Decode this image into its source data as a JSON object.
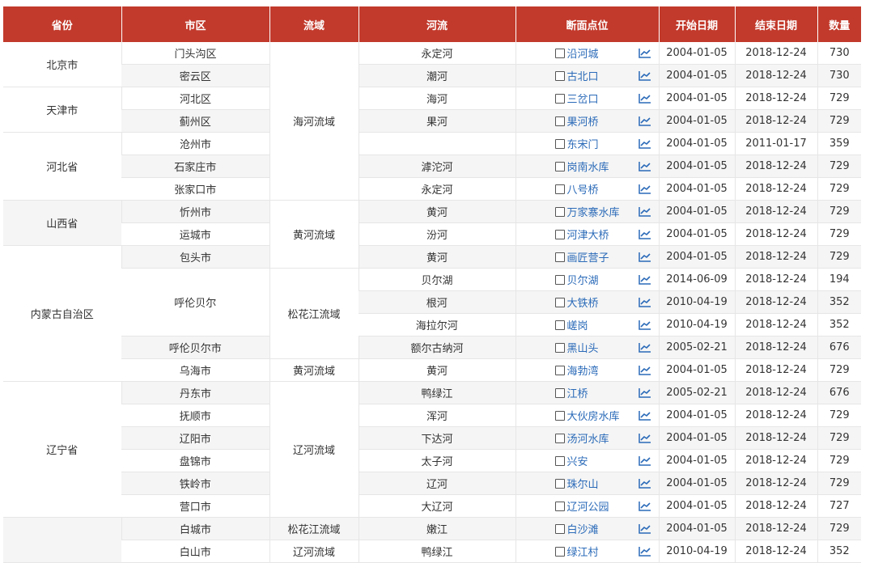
{
  "header": {
    "province": "省份",
    "city": "市区",
    "basin": "流域",
    "river": "河流",
    "site": "断面点位",
    "start": "开始日期",
    "end": "结束日期",
    "count": "数量"
  },
  "colors": {
    "header_bg": "#c23a2c",
    "link": "#2a6ab8",
    "row_alt": "#f5f5f5"
  },
  "icons": {
    "checkbox": "checkbox-icon",
    "trend": "line-chart-icon"
  },
  "provinces": [
    "北京市",
    "天津市",
    "河北省",
    "山西省",
    "内蒙古自治区",
    "辽宁省",
    ""
  ],
  "basins": [
    "海河流域",
    "黄河流域",
    "松花江流域",
    "黄河流域",
    "辽河流域",
    "松花江流域",
    "辽河流域"
  ],
  "cities": [
    "门头沟区",
    "密云区",
    "河北区",
    "蓟州区",
    "沧州市",
    "石家庄市",
    "张家口市",
    "忻州市",
    "运城市",
    "包头市",
    "呼伦贝尔",
    "呼伦贝尔市",
    "乌海市",
    "丹东市",
    "抚顺市",
    "辽阳市",
    "盘锦市",
    "铁岭市",
    "营口市",
    "白城市",
    "白山市"
  ],
  "rivers": [
    "永定河",
    "潮河",
    "海河",
    "果河",
    "",
    "滹沱河",
    "永定河",
    "黄河",
    "汾河",
    "黄河",
    "贝尔湖",
    "根河",
    "海拉尔河",
    "额尔古纳河",
    "黄河",
    "鸭绿江",
    "浑河",
    "下达河",
    "太子河",
    "辽河",
    "大辽河",
    "嫩江",
    "鸭绿江"
  ],
  "rows": [
    {
      "site": "沿河城",
      "start": "2004-01-05",
      "end": "2018-12-24",
      "count": "730"
    },
    {
      "site": "古北口",
      "start": "2004-01-05",
      "end": "2018-12-24",
      "count": "730"
    },
    {
      "site": "三岔口",
      "start": "2004-01-05",
      "end": "2018-12-24",
      "count": "729"
    },
    {
      "site": "果河桥",
      "start": "2004-01-05",
      "end": "2018-12-24",
      "count": "729"
    },
    {
      "site": "东宋门",
      "start": "2004-01-05",
      "end": "2011-01-17",
      "count": "359"
    },
    {
      "site": "岗南水库",
      "start": "2004-01-05",
      "end": "2018-12-24",
      "count": "729"
    },
    {
      "site": "八号桥",
      "start": "2004-01-05",
      "end": "2018-12-24",
      "count": "729"
    },
    {
      "site": "万家寨水库",
      "start": "2004-01-05",
      "end": "2018-12-24",
      "count": "729"
    },
    {
      "site": "河津大桥",
      "start": "2004-01-05",
      "end": "2018-12-24",
      "count": "729"
    },
    {
      "site": "画匠营子",
      "start": "2004-01-05",
      "end": "2018-12-24",
      "count": "729"
    },
    {
      "site": "贝尔湖",
      "start": "2014-06-09",
      "end": "2018-12-24",
      "count": "194"
    },
    {
      "site": "大铁桥",
      "start": "2010-04-19",
      "end": "2018-12-24",
      "count": "352"
    },
    {
      "site": "嵯岗",
      "start": "2010-04-19",
      "end": "2018-12-24",
      "count": "352"
    },
    {
      "site": "黑山头",
      "start": "2005-02-21",
      "end": "2018-12-24",
      "count": "676"
    },
    {
      "site": "海勃湾",
      "start": "2004-01-05",
      "end": "2018-12-24",
      "count": "729"
    },
    {
      "site": "江桥",
      "start": "2005-02-21",
      "end": "2018-12-24",
      "count": "676"
    },
    {
      "site": "大伙房水库",
      "start": "2004-01-05",
      "end": "2018-12-24",
      "count": "729"
    },
    {
      "site": "汤河水库",
      "start": "2004-01-05",
      "end": "2018-12-24",
      "count": "729"
    },
    {
      "site": "兴安",
      "start": "2004-01-05",
      "end": "2018-12-24",
      "count": "729"
    },
    {
      "site": "珠尔山",
      "start": "2004-01-05",
      "end": "2018-12-24",
      "count": "729"
    },
    {
      "site": "辽河公园",
      "start": "2004-01-05",
      "end": "2018-12-24",
      "count": "727"
    },
    {
      "site": "白沙滩",
      "start": "2004-01-05",
      "end": "2018-12-24",
      "count": "729"
    },
    {
      "site": "绿江村",
      "start": "2010-04-19",
      "end": "2018-12-24",
      "count": "352"
    }
  ]
}
